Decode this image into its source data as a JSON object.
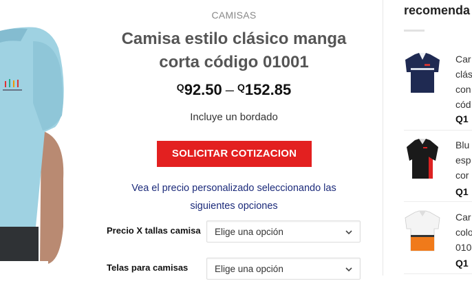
{
  "product": {
    "category": "CAMISAS",
    "title": "Camisa estilo clásico manga corta código 01001",
    "price_min_symbol": "Q",
    "price_min": "92.50",
    "price_sep": "–",
    "price_max_symbol": "Q",
    "price_max": "152.85",
    "includes": "Incluye un bordado",
    "quote_button": "SOLICITAR COTIZACION",
    "info_text": "Vea el precio personalizado seleccionando las siguientes opciones",
    "options": [
      {
        "label": "Precio X tallas camisa",
        "value": "Elige una opción"
      },
      {
        "label": "Telas para camisas",
        "value": "Elige una opción"
      }
    ]
  },
  "sidebar": {
    "title": "recomenda",
    "items": [
      {
        "name_lines": [
          "Car",
          "clás",
          "con",
          "cód"
        ],
        "price": "Q1",
        "icon": "navy-shirt-image"
      },
      {
        "name_lines": [
          "Blu",
          "esp",
          "cor"
        ],
        "price": "Q1",
        "icon": "black-red-blouse-image"
      },
      {
        "name_lines": [
          "Car",
          "colo",
          "010"
        ],
        "price": "Q1",
        "icon": "orange-white-shirt-image"
      }
    ]
  },
  "colors": {
    "accent": "#e32020",
    "link": "#1b2a7a"
  }
}
